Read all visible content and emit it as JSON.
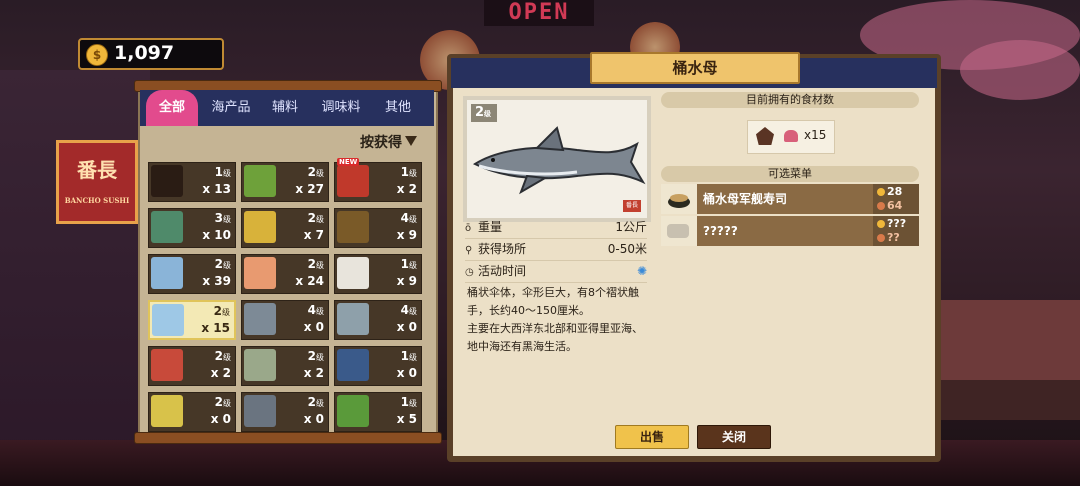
{
  "hud": {
    "coins": "1,097",
    "coin_symbol": "$"
  },
  "scene": {
    "open_sign": "OPEN",
    "shop_sign": "番長",
    "shop_sign_sub": "BANCHO SUSHI"
  },
  "inventory": {
    "tabs": [
      "全部",
      "海产品",
      "辅料",
      "调味料",
      "其他"
    ],
    "active_tab": "全部",
    "sort_label": "按获得",
    "items": [
      {
        "icon": "soy-sauce-icon",
        "level": "1",
        "count": "x 13",
        "color": "#2a1c14"
      },
      {
        "icon": "seaweed-icon",
        "level": "2",
        "count": "x 27",
        "color": "#6ea13a"
      },
      {
        "icon": "sauce-jar-icon",
        "level": "1",
        "count": "x 2",
        "color": "#c0392b",
        "new": "NEW"
      },
      {
        "icon": "green-fish-icon",
        "level": "3",
        "count": "x 10",
        "color": "#4f8a6a"
      },
      {
        "icon": "yellow-bottle-icon",
        "level": "2",
        "count": "x 7",
        "color": "#d8b23a"
      },
      {
        "icon": "anglerfish-icon",
        "level": "4",
        "count": "x 9",
        "color": "#7a5a28"
      },
      {
        "icon": "blue-jellyfish-icon",
        "level": "2",
        "count": "x 39",
        "color": "#8ab4d8"
      },
      {
        "icon": "crab-icon",
        "level": "2",
        "count": "x 24",
        "color": "#e89a70"
      },
      {
        "icon": "salt-icon",
        "level": "1",
        "count": "x 9",
        "color": "#e8e4dc"
      },
      {
        "icon": "barrel-jellyfish-icon",
        "level": "2",
        "count": "x 15",
        "color": "#9ec8e6",
        "selected": true
      },
      {
        "icon": "shark-head-icon",
        "level": "4",
        "count": "x 0",
        "color": "#7d8a96"
      },
      {
        "icon": "barracuda-icon",
        "level": "4",
        "count": "x 0",
        "color": "#8ea0aa"
      },
      {
        "icon": "lionfish-icon",
        "level": "2",
        "count": "x 2",
        "color": "#c84a3a"
      },
      {
        "icon": "eel-icon",
        "level": "2",
        "count": "x 2",
        "color": "#9aa88a"
      },
      {
        "icon": "striped-fish-icon",
        "level": "1",
        "count": "x 0",
        "color": "#3a5a8a"
      },
      {
        "icon": "yellow-fish-icon",
        "level": "2",
        "count": "x 0",
        "color": "#d8c24a"
      },
      {
        "icon": "grey-shark-icon",
        "level": "2",
        "count": "x 0",
        "color": "#6a7480"
      },
      {
        "icon": "green-bottle-icon",
        "level": "1",
        "count": "x 5",
        "color": "#5a9a3a"
      }
    ],
    "level_suffix": "级"
  },
  "detail": {
    "title": "桶水母",
    "grade": "2",
    "grade_suffix": "级",
    "stamp": "番長",
    "rows": [
      {
        "icon": "weight-icon",
        "label": "重量",
        "value": "1公斤"
      },
      {
        "icon": "location-icon",
        "label": "获得场所",
        "value": "0-50米"
      },
      {
        "icon": "clock-icon",
        "label": "活动时间",
        "value": ""
      }
    ],
    "description": "桶状伞体，伞形巨大，有8个褶状触手，长约40～150厘米。\n主要在大西洋东北部和亚得里亚海、地中海还有黑海生活。",
    "owned_header": "目前拥有的食材数",
    "owned_count": "x15",
    "menu_header": "可选菜单",
    "dishes": [
      {
        "name": "桶水母军舰寿司",
        "price": "28",
        "taste": "64"
      },
      {
        "name": "?????",
        "price": "???",
        "taste": "??"
      }
    ],
    "buttons": {
      "sell": "出售",
      "close": "关闭"
    }
  }
}
